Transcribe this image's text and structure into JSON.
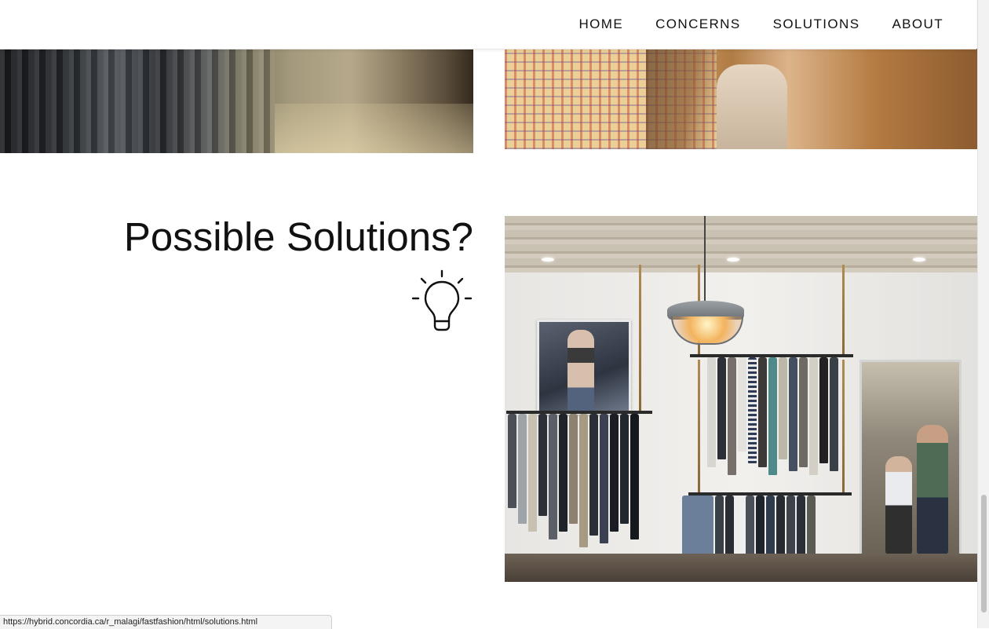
{
  "nav": {
    "links": [
      "HOME",
      "CONCERNS",
      "SOLUTIONS",
      "ABOUT"
    ]
  },
  "section": {
    "title": "Possible Solutions?",
    "icon": "lightbulb-icon"
  },
  "images": {
    "top_left": "clothing-racks-photo",
    "top_right": "plaid-shirt-photo",
    "store": "clothing-store-photo"
  },
  "status_bar": {
    "url": "https://hybrid.concordia.ca/r_malagi/fastfashion/html/solutions.html"
  },
  "colors": {
    "text": "#111111",
    "background": "#ffffff"
  }
}
